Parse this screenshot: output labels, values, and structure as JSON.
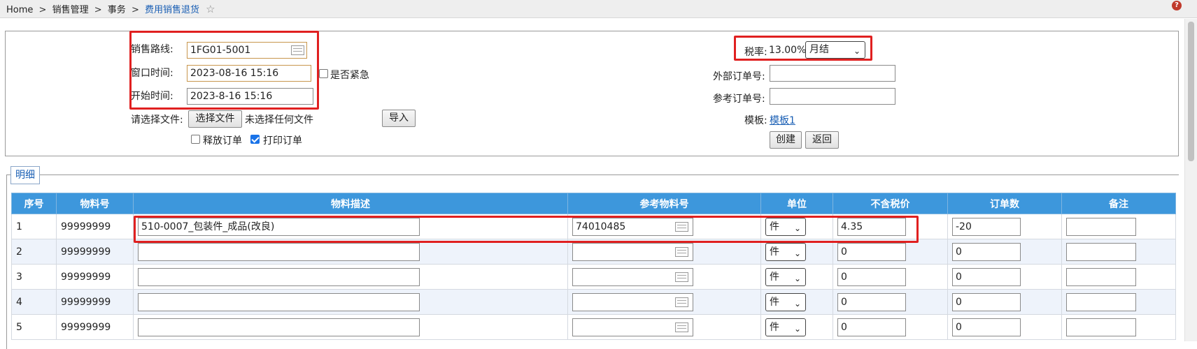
{
  "breadcrumb": {
    "home": "Home",
    "level1": "销售管理",
    "level2": "事务",
    "current": "费用销售退货",
    "separator": ">"
  },
  "form": {
    "route_label": "销售路线:",
    "route_value": "1FG01-5001",
    "window_time_label": "窗口时间:",
    "window_time_value": "2023-08-16 15:16",
    "start_time_label": "开始时间:",
    "start_time_value": "2023-8-16 15:16",
    "urgent_label": "是否紧急",
    "urgent_checked": false,
    "file_label": "请选择文件:",
    "choose_file_button": "选择文件",
    "no_file_text": "未选择任何文件",
    "import_button": "导入",
    "release_order_label": "释放订单",
    "release_order_checked": false,
    "print_order_label": "打印订单",
    "print_order_checked": true,
    "tax_label": "税率:",
    "tax_value": "13.00%",
    "settlement_value": "月结",
    "external_order_label": "外部订单号:",
    "external_order_value": "",
    "reference_order_label": "参考订单号:",
    "reference_order_value": "",
    "template_label": "模板:",
    "template_link": "模板1",
    "create_button": "创建",
    "back_button": "返回"
  },
  "detail": {
    "legend": "明细",
    "columns": [
      "序号",
      "物料号",
      "物料描述",
      "参考物料号",
      "单位",
      "不含税价",
      "订单数",
      "备注"
    ],
    "rows": [
      {
        "seq": "1",
        "material": "99999999",
        "description": "510-0007_包装件_成品(改良)",
        "ref_material": "74010485",
        "unit": "件",
        "price": "4.35",
        "qty": "-20",
        "remark": ""
      },
      {
        "seq": "2",
        "material": "99999999",
        "description": "",
        "ref_material": "",
        "unit": "件",
        "price": "0",
        "qty": "0",
        "remark": ""
      },
      {
        "seq": "3",
        "material": "99999999",
        "description": "",
        "ref_material": "",
        "unit": "件",
        "price": "0",
        "qty": "0",
        "remark": ""
      },
      {
        "seq": "4",
        "material": "99999999",
        "description": "",
        "ref_material": "",
        "unit": "件",
        "price": "0",
        "qty": "0",
        "remark": ""
      },
      {
        "seq": "5",
        "material": "99999999",
        "description": "",
        "ref_material": "",
        "unit": "件",
        "price": "0",
        "qty": "0",
        "remark": ""
      }
    ]
  },
  "icons": {
    "favorite": "star-icon",
    "help": "help-icon",
    "lookup": "lookup-icon",
    "dropdown": "chevron-down-icon"
  },
  "colors": {
    "table_header": "#3d97dc",
    "alt_row": "#eef3fb",
    "highlight": "#e02020",
    "link": "#1a5fb4"
  }
}
